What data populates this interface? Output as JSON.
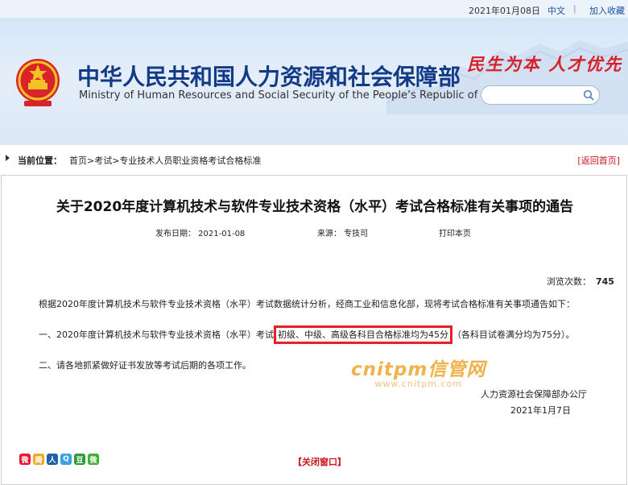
{
  "top_bar": {
    "date": "2021年01月08日",
    "lang": "中文",
    "separator": "|",
    "favorite": "加入收藏"
  },
  "header": {
    "title_cn": "中华人民共和国人力资源和社会保障部",
    "title_en": "Ministry of Human Resources and Social Security of the People’s Republic of China",
    "slogan": "民生为本 人才优先",
    "search_placeholder": ""
  },
  "breadcrumb": {
    "label": "当前位置：",
    "path": "首页>考试>专业技术人员职业资格考试合格标准",
    "back": "[返回首页]"
  },
  "article": {
    "title": "关于2020年度计算机技术与软件专业技术资格（水平）考试合格标准有关事项的通告",
    "publish_date": "发布日期：  2021-01-08",
    "source": "来源：  专技司",
    "print": "打印本页",
    "views_label": "浏览次数：",
    "views_count": "745",
    "para1": "根据2020年度计算机技术与软件专业技术资格（水平）考试数据统计分析，经商工业和信息化部，现将考试合格标准有关事项通告如下：",
    "para2_before": "一、2020年度计算机技术与软件专业技术资格（水平）考试",
    "para2_highlight": "初级、中级、高级各科目合格标准均为45分",
    "para2_after": "（各科目试卷满分均为75分）。",
    "para3": "二、请各地抓紧做好证书发放等考试后期的各项工作。",
    "signature_org": "人力资源社会保障部办公厅",
    "signature_date": "2021年1月7日",
    "close_window": "【关闭窗口】"
  },
  "watermark": {
    "brand": "cnitpm信管网",
    "url": "www.cnitpm.com"
  },
  "share_icons": [
    {
      "name": "weibo-icon",
      "color": "#e6162d",
      "glyph": "微"
    },
    {
      "name": "tencent-weibo-icon",
      "color": "#f5a623",
      "glyph": "腾"
    },
    {
      "name": "renren-icon",
      "color": "#1d5fa8",
      "glyph": "人"
    },
    {
      "name": "qzone-icon",
      "color": "#36a3e0",
      "glyph": "Q"
    },
    {
      "name": "douban-icon",
      "color": "#2b9b3a",
      "glyph": "豆"
    },
    {
      "name": "wechat-icon",
      "color": "#3cb034",
      "glyph": "微"
    }
  ]
}
